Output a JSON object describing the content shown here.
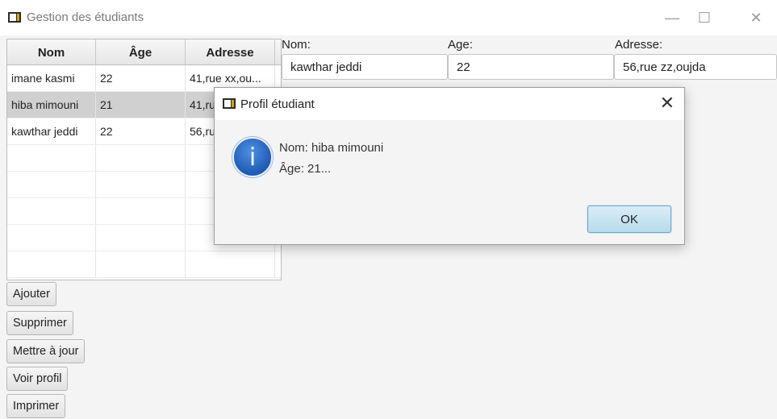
{
  "window": {
    "title": "Gestion des étudiants",
    "minimize_glyph": "—",
    "maximize_glyph": "☐",
    "close_glyph": "✕"
  },
  "table": {
    "columns": [
      "Nom",
      "Âge",
      "Adresse"
    ],
    "rows": [
      [
        "imane kasmi",
        "22",
        "41,rue xx,ou..."
      ],
      [
        "hiba mimouni",
        "21",
        "41,ru"
      ],
      [
        "kawthar jeddi",
        "22",
        "56,ru"
      ]
    ],
    "selected_row": 1
  },
  "form": {
    "nom_label": "Nom:",
    "age_label": "Age:",
    "adresse_label": "Adresse:",
    "nom_value": "kawthar jeddi",
    "age_value": "22",
    "adresse_value": "56,rue zz,oujda"
  },
  "buttons": {
    "ajouter": "Ajouter",
    "supprimer": "Supprimer",
    "mettre_a_jour": "Mettre à jour",
    "voir_profil": "Voir profil",
    "imprimer": "Imprimer"
  },
  "dialog": {
    "title": "Profil étudiant",
    "close_glyph": "✕",
    "icon_glyph": "i",
    "line1": "Nom: hiba mimouni",
    "line2": "Âge: 21...",
    "ok_label": "OK"
  },
  "colors": {
    "selected_row": "#d0d0d0",
    "info_icon": "#1d5bb5",
    "ok_button": "#b7dbea"
  }
}
